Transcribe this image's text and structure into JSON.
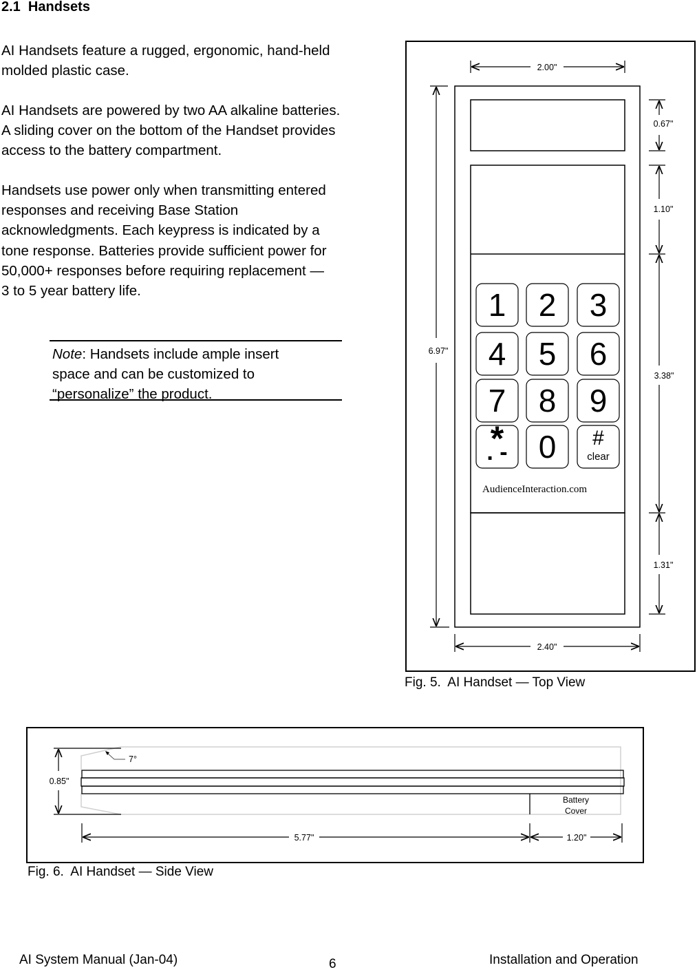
{
  "section": {
    "heading": "2.1  Handsets"
  },
  "paragraphs": [
    {
      "lines": [
        "AI Handsets feature a rugged, ergonomic, hand-held",
        "molded plastic case."
      ]
    },
    {
      "lines": [
        "AI Handsets are powered by two AA alkaline batteries.",
        "A sliding cover on the bottom of the Handset provides",
        "access to the battery compartment."
      ]
    },
    {
      "lines": [
        "Handsets use power only when transmitting entered",
        "responses and receiving Base Station",
        "acknowledgments.  Each keypress is indicated by a",
        "tone response.  Batteries provide sufficient power for",
        "50,000+ responses before requiring replacement —",
        "3 to 5 year battery life."
      ]
    }
  ],
  "note": {
    "label": "Note",
    "line1_rest": ":  Handsets include ample insert",
    "line2": "space and can be customized to",
    "line3": "“personalize” the product."
  },
  "figure_top": {
    "caption": "Fig. 5.  AI Handset — Top View",
    "dimensions": {
      "inner_width": "2.00\"",
      "outer_width": "2.40\"",
      "total_length": "6.97\"",
      "display_height": "0.67\"",
      "upper_panel_height": "1.10\"",
      "keypad_height": "3.38\"",
      "lower_panel_height": "1.31\""
    },
    "keypad": [
      {
        "key": "1"
      },
      {
        "key": "2"
      },
      {
        "key": "3"
      },
      {
        "key": "4"
      },
      {
        "key": "5"
      },
      {
        "key": "6"
      },
      {
        "key": "7"
      },
      {
        "key": "8"
      },
      {
        "key": "9"
      },
      {
        "key": "*",
        "sub": ". -"
      },
      {
        "key": "0"
      },
      {
        "key": "#",
        "sub": "clear"
      }
    ],
    "brand_text": "AudienceInteraction.com"
  },
  "figure_side": {
    "caption": "Fig. 6.  AI Handset — Side View",
    "dimensions": {
      "thickness": "0.85\"",
      "angle": "7°",
      "main_length": "5.77\"",
      "cover_length": "1.20\""
    },
    "battery_cover_label": [
      "Battery",
      "Cover"
    ]
  },
  "footer": {
    "left": "AI System Manual (Jan-04)",
    "page_number": "6",
    "right": "Installation and Operation"
  }
}
